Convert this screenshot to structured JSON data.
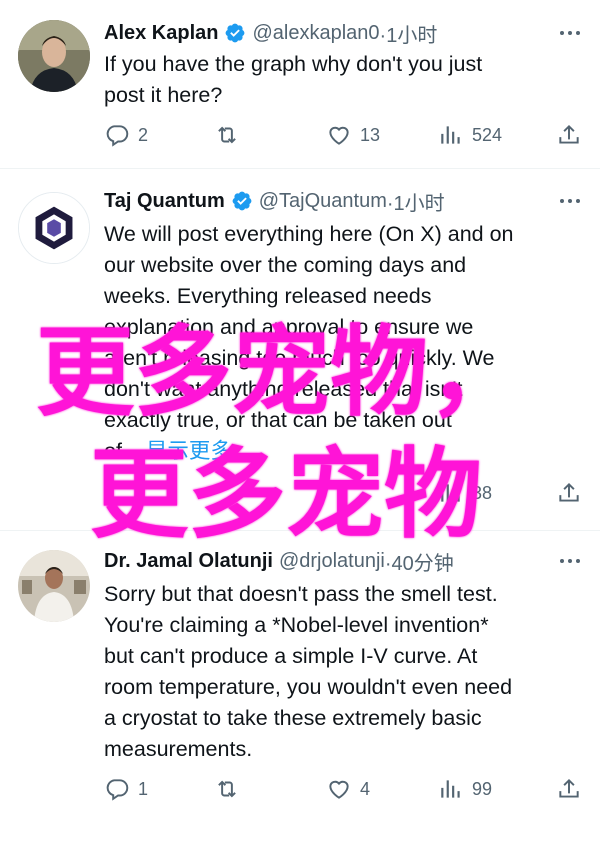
{
  "tweets": [
    {
      "name": "Alex Kaplan",
      "handle": "@alexkaplan0",
      "time": "·1小时",
      "text": [
        "If you have the graph why don't you just",
        "post it here?"
      ],
      "replies": "2",
      "retweets": "",
      "likes": "13",
      "views": "524"
    },
    {
      "name": "Taj Quantum",
      "handle": "@TajQuantum",
      "time": "·1小时",
      "text": [
        "We will post everything here (On X) and on",
        "our website over the coming days and",
        "weeks. Everything released needs",
        "explanation and approval to ensure we",
        "aren't releasing too much too quickly. We",
        "don't want anything released that isn't",
        "exactly true, or that can be taken out"
      ],
      "text_tail": "of...",
      "show_more": "显示更多",
      "views": "38"
    },
    {
      "name": "Dr. Jamal Olatunji",
      "handle": "@drjolatunji",
      "time": "·40分钟",
      "text": [
        "Sorry but that doesn't pass the smell test.",
        "You're claiming a *Nobel-level invention*",
        "but can't produce a simple I-V curve. At",
        "room temperature, you wouldn't even need",
        "a cryostat to take these extremely basic",
        "measurements."
      ],
      "replies": "1",
      "retweets": "",
      "likes": "4",
      "views": "99"
    }
  ],
  "overlay": {
    "line1": "更多宠物，",
    "line2": "更多宠物",
    "color": "#ff14d7"
  },
  "colors": {
    "verified": "#1d9bf0",
    "secondary_text": "#536471",
    "link": "#1d9bf0"
  },
  "icons": [
    "reply-icon",
    "retweet-icon",
    "like-icon",
    "views-icon",
    "share-icon",
    "more-icon",
    "verified-badge-icon"
  ]
}
